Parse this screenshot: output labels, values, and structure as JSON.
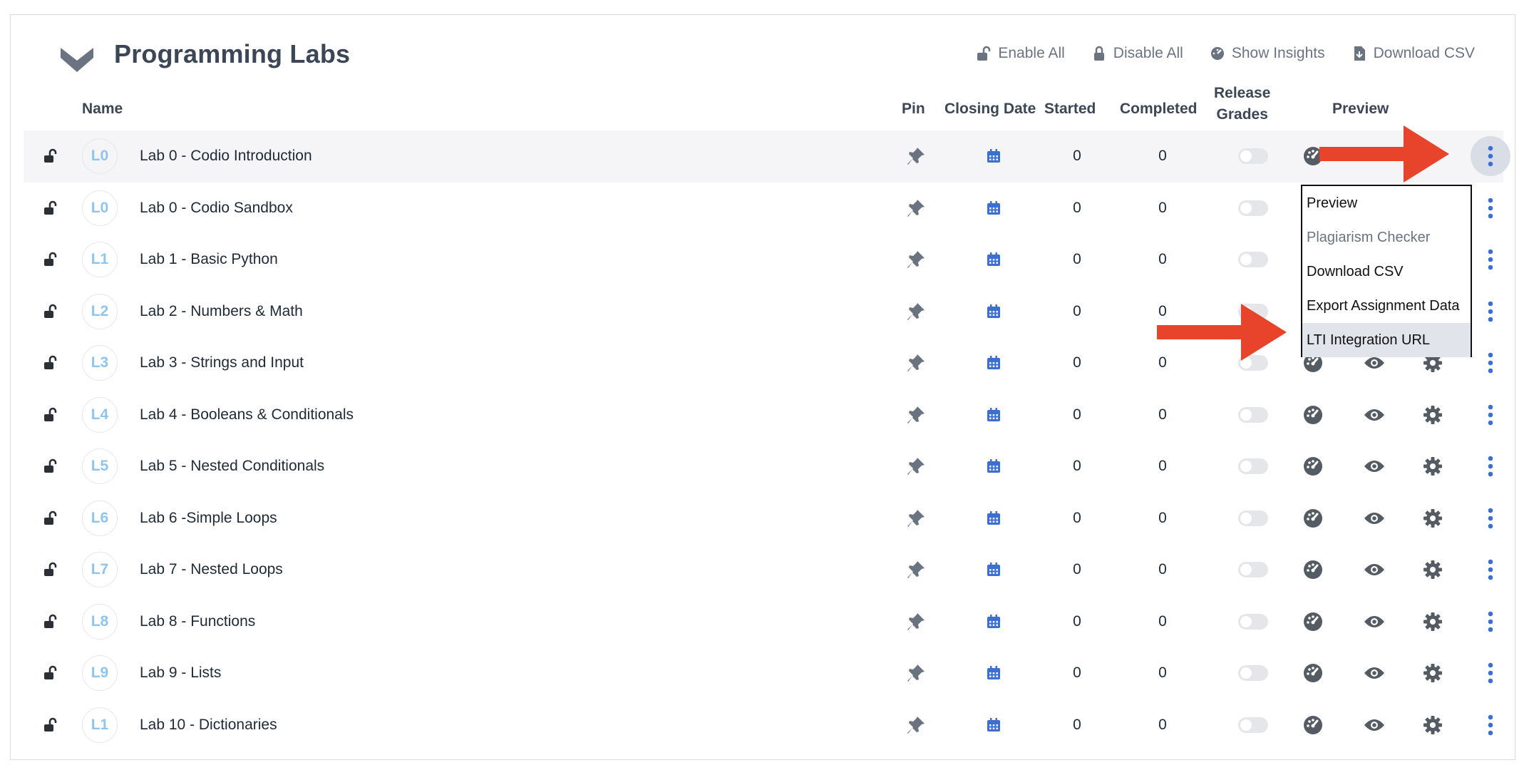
{
  "header": {
    "title": "Programming Labs",
    "actions": [
      {
        "label": "Enable All",
        "icon": "unlock-icon"
      },
      {
        "label": "Disable All",
        "icon": "lock-icon"
      },
      {
        "label": "Show Insights",
        "icon": "dashboard-icon"
      },
      {
        "label": "Download CSV",
        "icon": "file-download-icon"
      }
    ]
  },
  "columns": {
    "name": "Name",
    "pin": "Pin",
    "closing_date": "Closing Date",
    "started": "Started",
    "completed": "Completed",
    "release_grades_1": "Release",
    "release_grades_2": "Grades",
    "preview": "Preview"
  },
  "rows": [
    {
      "badge": "L0",
      "name": "Lab 0 - Codio Introduction",
      "started": "0",
      "completed": "0"
    },
    {
      "badge": "L0",
      "name": "Lab 0 - Codio Sandbox",
      "started": "0",
      "completed": "0"
    },
    {
      "badge": "L1",
      "name": "Lab 1 - Basic Python",
      "started": "0",
      "completed": "0"
    },
    {
      "badge": "L2",
      "name": "Lab 2 - Numbers & Math",
      "started": "0",
      "completed": "0"
    },
    {
      "badge": "L3",
      "name": "Lab 3 - Strings and Input",
      "started": "0",
      "completed": "0"
    },
    {
      "badge": "L4",
      "name": "Lab 4 - Booleans & Conditionals",
      "started": "0",
      "completed": "0"
    },
    {
      "badge": "L5",
      "name": "Lab 5 - Nested Conditionals",
      "started": "0",
      "completed": "0"
    },
    {
      "badge": "L6",
      "name": "Lab 6 -Simple Loops",
      "started": "0",
      "completed": "0"
    },
    {
      "badge": "L7",
      "name": "Lab 7 - Nested Loops",
      "started": "0",
      "completed": "0"
    },
    {
      "badge": "L8",
      "name": "Lab 8 - Functions",
      "started": "0",
      "completed": "0"
    },
    {
      "badge": "L9",
      "name": "Lab 9 - Lists",
      "started": "0",
      "completed": "0"
    },
    {
      "badge": "L1",
      "name": "Lab 10 - Dictionaries",
      "started": "0",
      "completed": "0"
    }
  ],
  "menu": {
    "items": [
      {
        "label": "Preview",
        "state": "normal"
      },
      {
        "label": "Plagiarism Checker",
        "state": "disabled"
      },
      {
        "label": "Download CSV",
        "state": "normal"
      },
      {
        "label": "Export Assignment Data",
        "state": "normal"
      },
      {
        "label": "LTI Integration URL",
        "state": "selected"
      }
    ]
  },
  "colors": {
    "accent_blue": "#3b6fd4",
    "badge_text": "#8ec5ef",
    "annotation_arrow": "#e8432b",
    "icon_gray": "#555b63"
  }
}
